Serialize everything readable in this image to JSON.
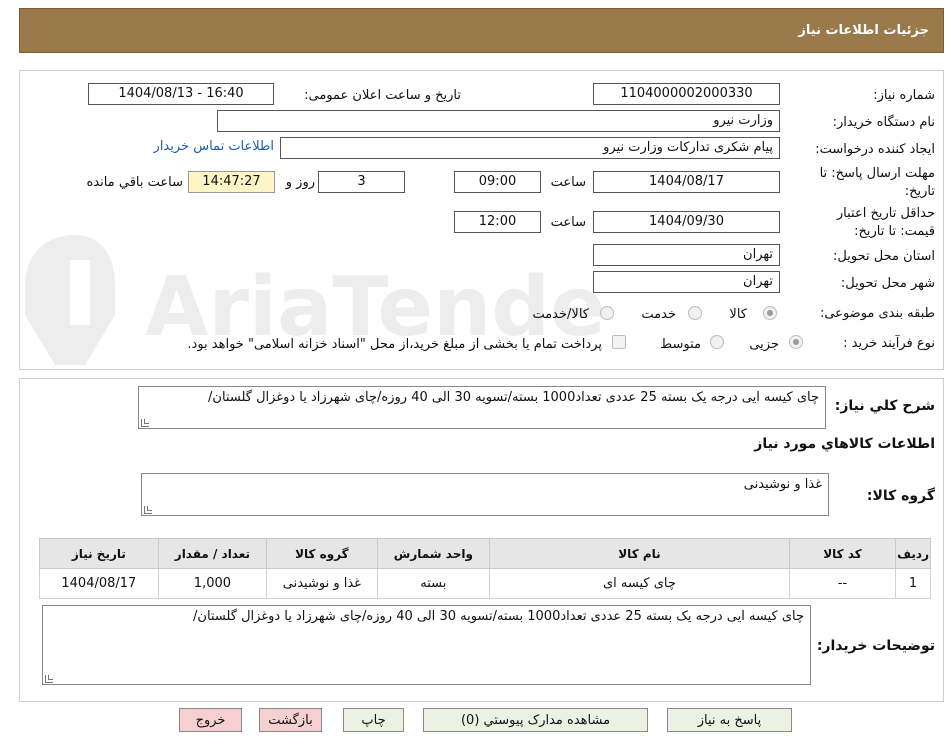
{
  "header": {
    "title": "جزئیات اطلاعات نیاز"
  },
  "form": {
    "need_number_label": "شماره نیاز:",
    "need_number": "1104000002000330",
    "announce_label": "تاریخ و ساعت اعلان عمومی:",
    "announce_value": "1404/08/13 - 16:40",
    "buyer_label": "نام دستگاه خریدار:",
    "buyer_value": "وزارت نیرو",
    "creator_label": "ایجاد کننده درخواست:",
    "creator_value": "پیام شکری تدارکات وزارت نیرو",
    "contact_link": "اطلاعات تماس خریدار",
    "deadline_label_1": "مهلت ارسال پاسخ: تا",
    "deadline_label_2": "تاریخ:",
    "deadline_date": "1404/08/17",
    "time_word": "ساعت",
    "deadline_time": "09:00",
    "days_value": "3",
    "days_suffix": "روز و",
    "remaining_time": "14:47:27",
    "remaining_suffix": "ساعت باقي مانده",
    "validity_label_1": "حداقل تاریخ اعتبار",
    "validity_label_2": "قیمت: تا تاریخ:",
    "validity_date": "1404/09/30",
    "validity_time_word": "ساعت",
    "validity_time": "12:00",
    "province_label": "استان محل تحویل:",
    "province_value": "تهران",
    "city_label": "شهر محل تحویل:",
    "city_value": "تهران",
    "category_label": "طبقه بندی موضوعی:",
    "category_options": [
      "کالا",
      "خدمت",
      "کالا/خدمت"
    ],
    "category_selected": "کالا",
    "process_label": "نوع فرآیند خرید :",
    "process_options": [
      "جزیی",
      "متوسط"
    ],
    "process_selected": "جزیی",
    "payment_note": "پرداخت تمام یا بخشی از مبلغ خرید،از محل \"اسناد خزانه اسلامی\" خواهد بود."
  },
  "watermark": {
    "text": "AriaTender.neT"
  },
  "need_summary": {
    "label": "شرح کلي نياز:",
    "text": "چای کیسه ایی درجه یک بسته 25 عددی تعداد1000 بسته/تسویه 30 الی 40 روزه/چای شهرزاد یا دوغزال گلستان/"
  },
  "goods": {
    "section_title": "اطلاعات کالاهاي مورد نياز",
    "group_label": "گروه کالا:",
    "group_value": "غذا و نوشیدنی",
    "columns": [
      "ردیف",
      "کد کالا",
      "نام کالا",
      "واحد شمارش",
      "گروه کالا",
      "تعداد / مقدار",
      "تاریخ نیاز"
    ],
    "rows": [
      [
        "1",
        "--",
        "چای کیسه ای",
        "بسته",
        "غذا و نوشیدنی",
        "1,000",
        "1404/08/17"
      ]
    ]
  },
  "buyer_notes": {
    "label": "توضیحات خریدار:",
    "text": "چای کیسه ایی درجه یک بسته 25 عددی تعداد1000 بسته/تسویه 30 الی 40 روزه/چای شهرزاد یا دوغزال گلستان/"
  },
  "buttons": {
    "reply": "پاسخ به نیاز",
    "attachments": "مشاهده مدارک پیوستي (0)",
    "print": "چاپ",
    "back": "بازگشت",
    "exit": "خروج"
  }
}
